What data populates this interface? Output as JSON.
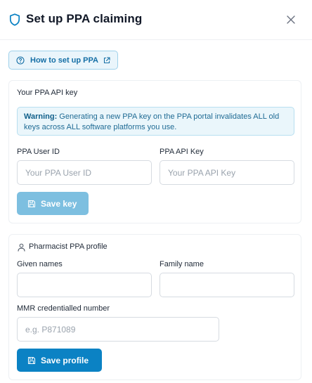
{
  "dialog": {
    "title": "Set up PPA claiming",
    "icons": {
      "title": "shield-icon",
      "close": "close-icon"
    }
  },
  "help_link": {
    "label": "How to set up PPA",
    "icons": {
      "leading": "help-circle-icon",
      "trailing": "external-link-icon"
    }
  },
  "api_key_section": {
    "title": "Your PPA API key",
    "warning": {
      "bold": "Warning:",
      "text": " Generating a new PPA key on the PPA portal invalidates ALL old keys across ALL software platforms you use."
    },
    "user_id": {
      "label": "PPA User ID",
      "placeholder": "Your PPA User ID",
      "value": ""
    },
    "api_key": {
      "label": "PPA API Key",
      "placeholder": "Your PPA API Key",
      "value": ""
    },
    "save_button": {
      "label": "Save key",
      "state": "disabled",
      "icon": "save-icon"
    }
  },
  "profile_section": {
    "title": "Pharmacist PPA profile",
    "icon": "person-icon",
    "given_names": {
      "label": "Given names",
      "placeholder": "",
      "value": ""
    },
    "family_name": {
      "label": "Family name",
      "placeholder": "",
      "value": ""
    },
    "mmr": {
      "label": "MMR credentialled number",
      "placeholder": "e.g. P871089",
      "value": ""
    },
    "save_button": {
      "label": "Save profile",
      "state": "enabled",
      "icon": "save-icon"
    }
  },
  "colors": {
    "accent": "#0b82c4",
    "accent_disabled": "#7dbfe0",
    "warning_bg": "#eaf6fb",
    "link": "#156fa6"
  }
}
